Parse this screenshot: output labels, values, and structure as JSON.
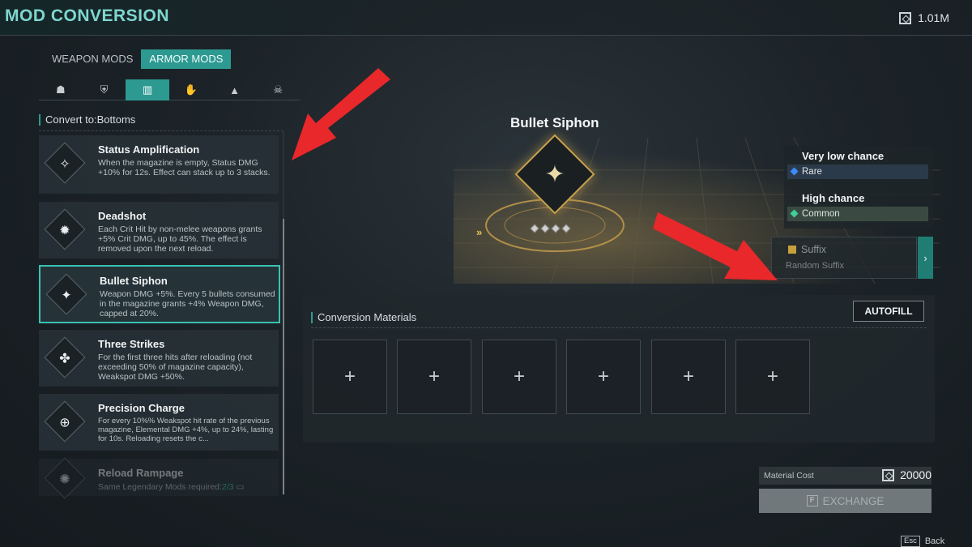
{
  "header": {
    "title": "MOD CONVERSION",
    "currency_icon": "material-cube-icon",
    "currency_value": "1.01M"
  },
  "tabs": [
    {
      "label": "WEAPON MODS"
    },
    {
      "label": "ARMOR MODS"
    }
  ],
  "categories": [
    {
      "icon": "helmet-icon",
      "glyph": "☗"
    },
    {
      "icon": "chest-armor-icon",
      "glyph": "⛨"
    },
    {
      "icon": "bottoms-icon",
      "glyph": "▥"
    },
    {
      "icon": "gloves-icon",
      "glyph": "✋"
    },
    {
      "icon": "boots-icon",
      "glyph": "▲"
    },
    {
      "icon": "mask-icon",
      "glyph": "☠"
    }
  ],
  "convert_to": "Convert to:Bottoms",
  "mods": [
    {
      "name": "Status Amplification",
      "desc": "When the magazine is empty, Status DMG +10% for 12s. Effect can stack up to 3 stacks.",
      "icon": "status-amplification-icon",
      "glyph": "✧"
    },
    {
      "name": "Deadshot",
      "desc": "Each Crit Hit by non-melee weapons grants +5% Crit DMG, up to 45%. The effect is removed upon the next reload.",
      "icon": "deadshot-icon",
      "glyph": "✹"
    },
    {
      "name": "Bullet Siphon",
      "desc": "Weapon DMG +5%. Every 5 bullets consumed in the magazine grants +4% Weapon DMG, capped at 20%.",
      "icon": "bullet-siphon-icon",
      "glyph": "✦"
    },
    {
      "name": "Three Strikes",
      "desc": "For the first three hits after reloading (not exceeding 50% of magazine capacity), Weakspot DMG +50%.",
      "icon": "three-strikes-icon",
      "glyph": "✤"
    },
    {
      "name": "Precision Charge",
      "desc": "For every 10%% Weakspot hit rate of the previous magazine, Elemental DMG +4%, up to 24%, lasting for 10s. Reloading resets the c...",
      "icon": "precision-charge-icon",
      "glyph": "⊕"
    },
    {
      "name": "Reload Rampage",
      "desc": "Same Legendary Mods required:",
      "req": "2/3",
      "icon": "reload-rampage-icon",
      "glyph": "✺",
      "locked": true
    }
  ],
  "preview": {
    "name": "Bullet Siphon",
    "icon": "bullet-siphon-large-icon",
    "glyph": "✦",
    "pips": 4
  },
  "chances": [
    {
      "title": "Very low chance",
      "rarity": "Rare",
      "color": "#3d8cff"
    },
    {
      "title": "High chance",
      "rarity": "Common",
      "color": "#3fcf9a"
    }
  ],
  "suffix": {
    "title": "Suffix",
    "subtitle": "Random Suffix",
    "next_glyph": "›"
  },
  "materials": {
    "title": "Conversion Materials",
    "autofill": "AUTOFILL",
    "slot_glyph": "+",
    "slot_count": 6
  },
  "cost": {
    "label": "Material Cost",
    "value": "20000"
  },
  "exchange": {
    "key": "F",
    "label": "EXCHANGE"
  },
  "back": {
    "key": "Esc",
    "label": "Back"
  }
}
